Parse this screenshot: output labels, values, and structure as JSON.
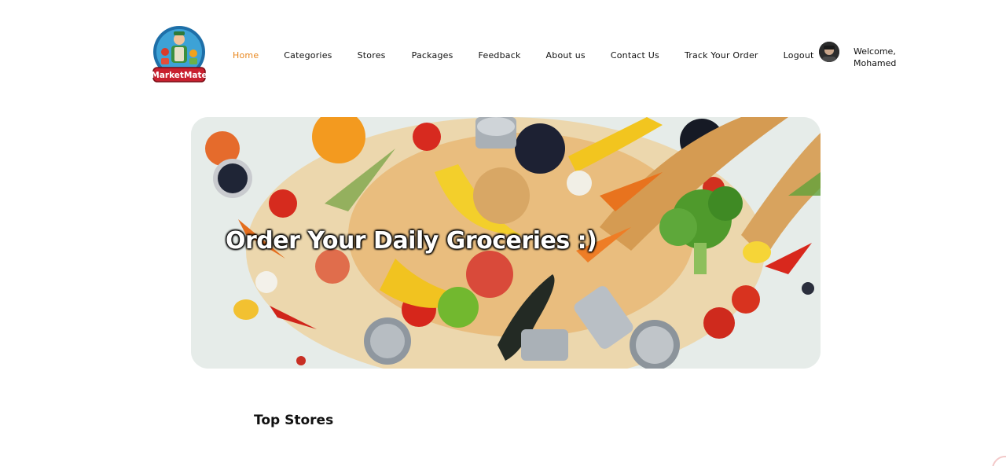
{
  "brand": {
    "logo_text": "MarketMate",
    "accent_color": "#e8871e",
    "logo_banner_color": "#c8202f",
    "logo_ring_color": "#1e6fa8"
  },
  "nav": {
    "items": [
      {
        "label": "Home",
        "active": true
      },
      {
        "label": "Categories",
        "active": false
      },
      {
        "label": "Stores",
        "active": false
      },
      {
        "label": "Packages",
        "active": false
      },
      {
        "label": "Feedback",
        "active": false
      },
      {
        "label": "About us",
        "active": false
      },
      {
        "label": "Contact Us",
        "active": false
      },
      {
        "label": "Track Your Order",
        "active": false
      },
      {
        "label": "Logout",
        "active": false
      }
    ]
  },
  "user": {
    "greeting": "Welcome,",
    "name": "Mohamed"
  },
  "hero": {
    "title": "Order Your Daily Groceries :)"
  },
  "sections": {
    "top_stores_title": "Top Stores"
  }
}
